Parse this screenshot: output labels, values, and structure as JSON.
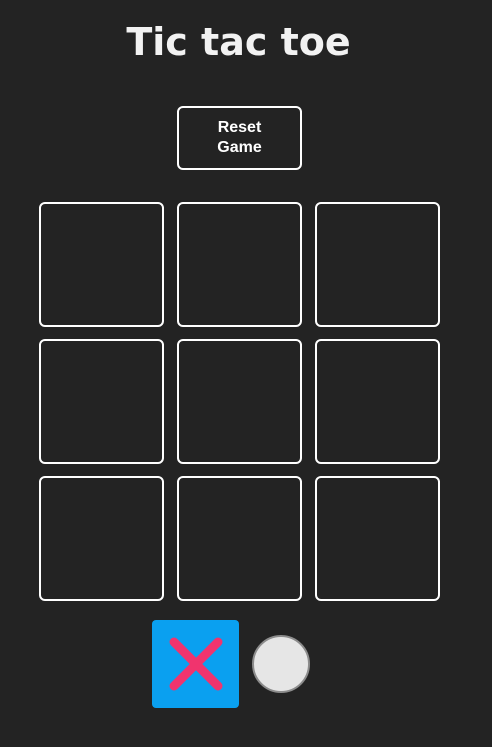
{
  "title": "Tic tac toe",
  "reset_button": {
    "label": "Reset Game"
  },
  "board": {
    "rows": 3,
    "cols": 3,
    "cells": [
      "",
      "",
      "",
      "",
      "",
      "",
      "",
      "",
      ""
    ]
  },
  "player_picker": {
    "selected": "x",
    "options": [
      {
        "symbol": "x",
        "icon": "x-mark-icon"
      },
      {
        "symbol": "o",
        "icon": "o-circle-icon"
      }
    ]
  },
  "colors": {
    "background": "#232323",
    "cell_border": "#ffffff",
    "x_selected_background": "#0aa0f0",
    "x_mark": "#f0346e",
    "o_fill": "#e6e6e6",
    "o_border": "#8c8c8c"
  }
}
